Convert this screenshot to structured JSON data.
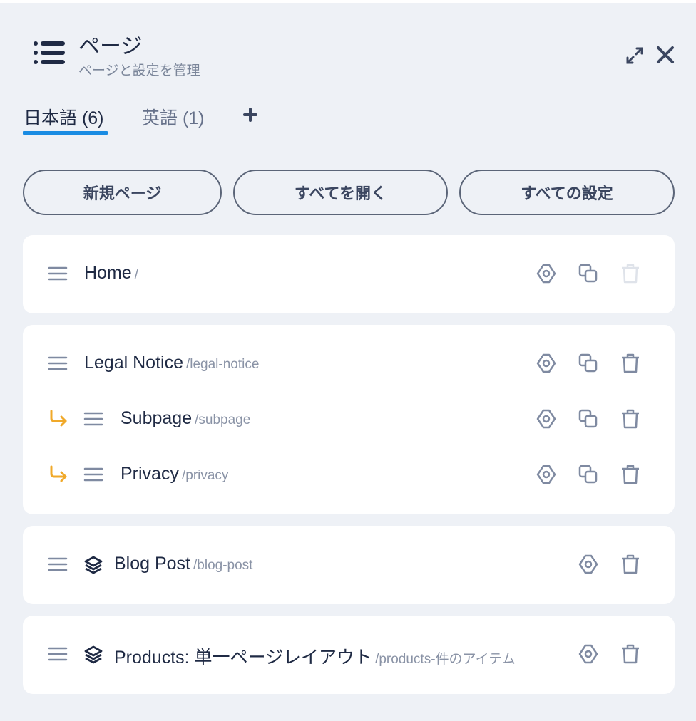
{
  "header": {
    "title": "ページ",
    "subtitle": "ページと設定を管理",
    "icons": [
      "list-icon",
      "expand-icon",
      "close-icon"
    ]
  },
  "tabs": [
    {
      "label": "日本語 (6)",
      "active": true
    },
    {
      "label": "英語 (1)",
      "active": false
    }
  ],
  "tab_add_icon": "plus-icon",
  "buttons": {
    "new_page": "新規ページ",
    "open_all": "すべてを開く",
    "all_settings": "すべての設定"
  },
  "pages": [
    {
      "title": "Home",
      "slug": "/",
      "delete_enabled": false
    },
    {
      "title": "Legal Notice",
      "slug": "/legal-notice",
      "delete_enabled": true
    },
    {
      "title": "Subpage",
      "slug": "/subpage",
      "delete_enabled": true,
      "child": true
    },
    {
      "title": "Privacy",
      "slug": "/privacy",
      "delete_enabled": true,
      "child": true
    },
    {
      "title": "Blog Post",
      "slug": "/blog-post",
      "template": true
    },
    {
      "title": "Products: 単一ページレイアウト",
      "slug": "/products-件のアイテム",
      "template": true
    }
  ],
  "colors": {
    "background": "#eef1f6",
    "accent": "#1a8ce3",
    "child_arrow": "#f0a92a",
    "icon": "#7f8aa1"
  }
}
